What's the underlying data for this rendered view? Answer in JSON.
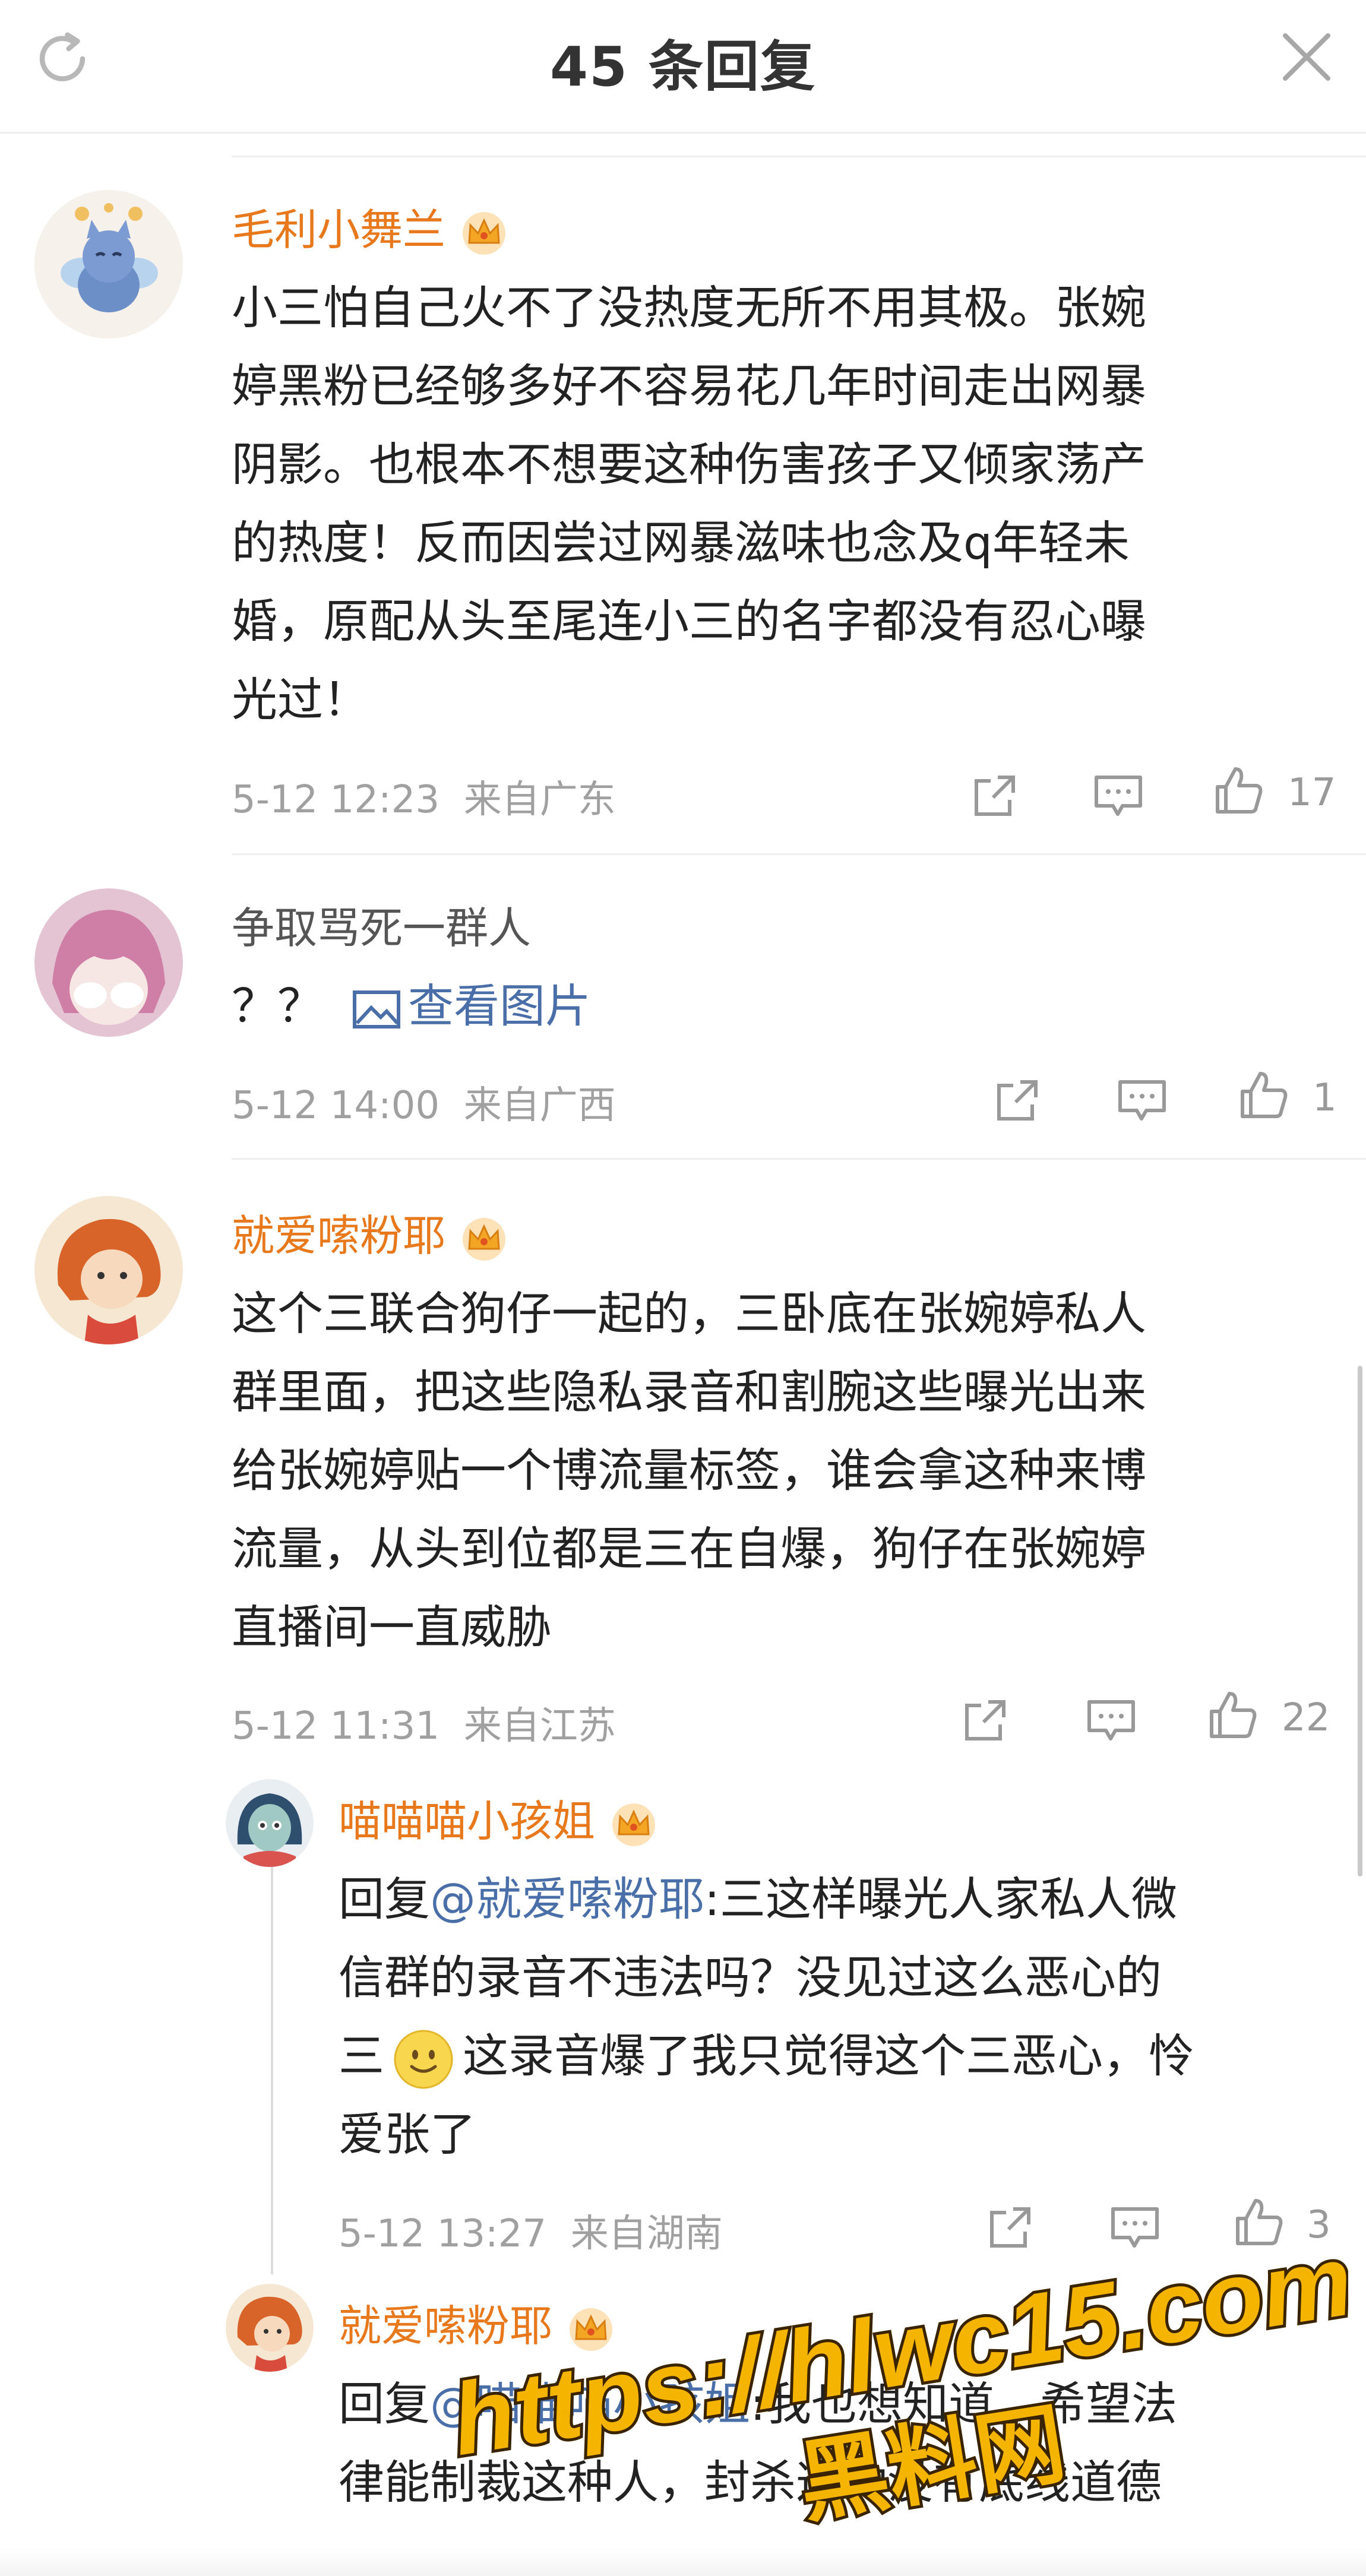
{
  "header": {
    "title": "45 条回复"
  },
  "comments": [
    {
      "username": "毛利小舞兰",
      "lines": [
        "小三怕自己火不了没热度无所不用其极。张婉",
        "婷黑粉已经够多好不容易花几年时间走出网暴",
        "阴影。也根本不想要这种伤害孩子又倾家荡产",
        "的热度！反而因尝过网暴滋味也念及q年轻未",
        "婚，原配从头至尾连小三的名字都没有忍心曝",
        "光过！"
      ],
      "time": "5-12 12:23",
      "location": "来自广东",
      "likes": "17"
    },
    {
      "username": "争取骂死一群人",
      "text_prefix": "？？",
      "view_picture": "查看图片",
      "time": "5-12 14:00",
      "location": "来自广西",
      "likes": "1"
    },
    {
      "username": "就爱嗦粉耶",
      "lines": [
        "这个三联合狗仔一起的，三卧底在张婉婷私人",
        "群里面，把这些隐私录音和割腕这些曝光出来",
        "给张婉婷贴一个博流量标签，谁会拿这种来博",
        "流量，从头到位都是三在自爆，狗仔在张婉婷",
        "直播间一直威胁"
      ],
      "time": "5-12 11:31",
      "location": "来自江苏",
      "likes": "22"
    }
  ],
  "replies": [
    {
      "username": "喵喵喵小孩姐",
      "reply_prefix": "回复",
      "mention": "@就爱嗦粉耶",
      "line1_rest": ":三这样曝光人家私人微",
      "line2": "信群的录音不违法吗？没见过这么恶心的",
      "line3_a": "三",
      "line3_b": "这录音爆了我只觉得这个三恶心，怜",
      "line4": "爱张了",
      "time": "5-12 13:27",
      "location": "来自湖南",
      "likes": "3"
    },
    {
      "username": "就爱嗦粉耶",
      "reply_prefix": "回复",
      "mention": "@喵喵喵小孩姐",
      "line1_rest": ":我也想知道，希望法",
      "line2": "律能制裁这种人，封杀这种没有底线道德"
    }
  ],
  "watermark": {
    "url": "https://hlwc15.com",
    "brand": "黑料网"
  },
  "colors": {
    "username": "#e8781c",
    "link": "#4a6fa8",
    "meta": "#a0a0a0"
  }
}
